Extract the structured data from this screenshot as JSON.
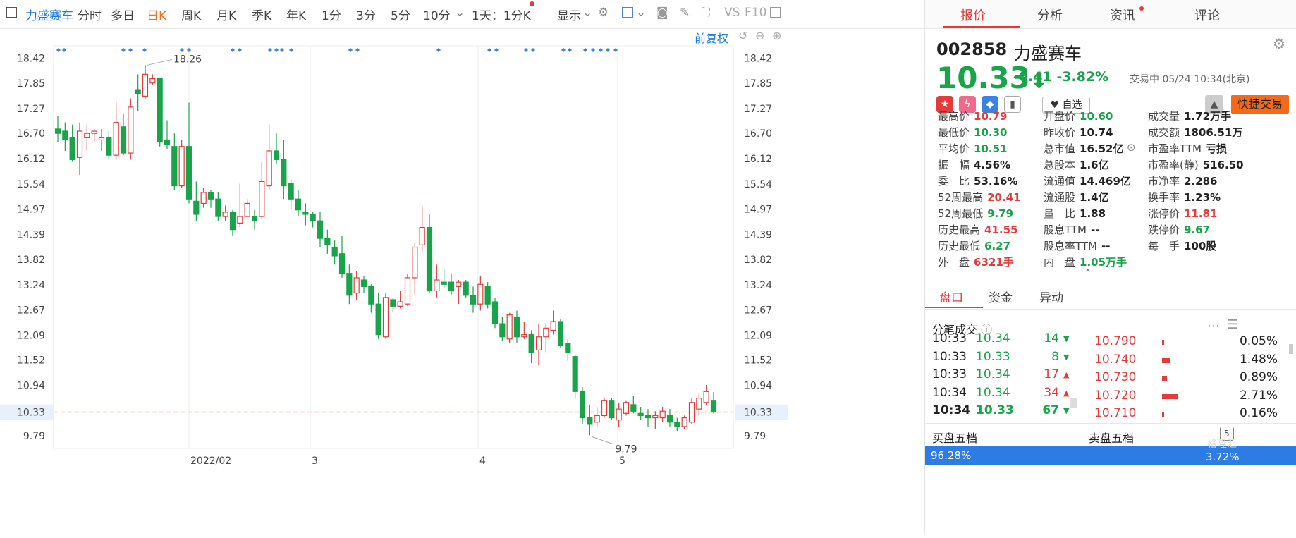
{
  "toolbar": {
    "stock_name": "力盛赛车",
    "periods": [
      "分时",
      "多日",
      "日K",
      "周K",
      "月K",
      "季K",
      "年K",
      "1分",
      "3分",
      "5分",
      "10分"
    ],
    "active_period": "日K",
    "dropdown": "1天：1分K",
    "display": "显示",
    "vs": "VS",
    "f10": "F10",
    "fuquan": "前复权"
  },
  "chart_data": {
    "type": "candlestick",
    "y_ticks": [
      "18.42",
      "17.85",
      "17.27",
      "16.70",
      "16.12",
      "15.54",
      "14.97",
      "14.39",
      "13.82",
      "13.24",
      "12.67",
      "12.09",
      "11.52",
      "10.94",
      "10.33",
      "9.79"
    ],
    "x_labels": [
      "2022/02",
      "3",
      "4",
      "5"
    ],
    "current_price_label": "10.33",
    "high_annotation": "18.26",
    "low_annotation": "9.79",
    "ylim": [
      9.5,
      18.7
    ],
    "candles": [
      [
        16.8,
        16.7,
        17.1,
        16.5
      ],
      [
        16.75,
        16.55,
        16.95,
        16.3
      ],
      [
        16.6,
        16.1,
        16.9,
        16.05
      ],
      [
        16.15,
        16.75,
        16.95,
        15.75
      ],
      [
        16.6,
        16.7,
        16.9,
        16.3
      ],
      [
        16.7,
        16.75,
        16.8,
        16.5
      ],
      [
        16.55,
        16.6,
        16.8,
        16.3
      ],
      [
        16.6,
        16.2,
        16.75,
        16.1
      ],
      [
        16.2,
        16.95,
        17.4,
        16.1
      ],
      [
        16.85,
        16.25,
        17.15,
        16.2
      ],
      [
        16.25,
        17.3,
        17.5,
        16.1
      ],
      [
        17.7,
        17.6,
        18.05,
        17.2
      ],
      [
        17.55,
        18.05,
        18.26,
        17.5
      ],
      [
        17.85,
        17.95,
        18.05,
        17.8
      ],
      [
        17.95,
        16.5,
        17.95,
        16.4
      ],
      [
        16.55,
        16.45,
        17.0,
        16.35
      ],
      [
        16.4,
        15.5,
        16.7,
        15.4
      ],
      [
        15.5,
        16.4,
        16.55,
        15.45
      ],
      [
        16.4,
        15.2,
        17.4,
        15.1
      ],
      [
        15.15,
        14.85,
        15.6,
        14.7
      ],
      [
        15.1,
        15.35,
        15.45,
        15.0
      ],
      [
        15.35,
        15.2,
        15.4,
        15.0
      ],
      [
        15.2,
        14.8,
        15.35,
        14.7
      ],
      [
        14.8,
        14.9,
        15.05,
        14.7
      ],
      [
        14.9,
        14.5,
        14.95,
        14.35
      ],
      [
        14.65,
        14.8,
        15.55,
        14.55
      ],
      [
        14.8,
        15.1,
        15.2,
        14.8
      ],
      [
        14.8,
        14.7,
        14.95,
        14.5
      ],
      [
        14.8,
        15.6,
        16.05,
        14.75
      ],
      [
        15.5,
        16.3,
        16.9,
        15.4
      ],
      [
        16.3,
        16.1,
        16.7,
        16.0
      ],
      [
        16.1,
        15.5,
        16.55,
        15.2
      ],
      [
        15.55,
        15.2,
        15.65,
        14.95
      ],
      [
        15.2,
        14.95,
        15.4,
        14.8
      ],
      [
        14.9,
        14.85,
        15.1,
        14.6
      ],
      [
        14.85,
        14.7,
        14.9,
        14.55
      ],
      [
        14.7,
        14.3,
        14.9,
        14.1
      ],
      [
        14.3,
        14.15,
        14.5,
        13.95
      ],
      [
        14.1,
        13.9,
        14.25,
        13.7
      ],
      [
        13.95,
        13.5,
        14.35,
        13.4
      ],
      [
        13.5,
        13.0,
        13.7,
        12.8
      ],
      [
        13.05,
        13.4,
        13.55,
        12.9
      ],
      [
        13.35,
        13.2,
        13.45,
        13.05
      ],
      [
        13.2,
        12.8,
        13.25,
        12.6
      ],
      [
        12.8,
        12.1,
        13.05,
        12.0
      ],
      [
        12.05,
        12.95,
        13.05,
        12.0
      ],
      [
        12.9,
        12.75,
        12.95,
        12.6
      ],
      [
        12.75,
        12.85,
        13.1,
        12.7
      ],
      [
        12.8,
        13.4,
        13.5,
        12.75
      ],
      [
        13.4,
        14.1,
        14.2,
        13.0
      ],
      [
        14.15,
        14.55,
        15.05,
        14.0
      ],
      [
        14.55,
        13.1,
        14.85,
        13.05
      ],
      [
        13.1,
        13.35,
        13.7,
        12.95
      ],
      [
        13.3,
        13.25,
        13.6,
        13.15
      ],
      [
        13.3,
        13.1,
        13.5,
        13.0
      ],
      [
        13.2,
        13.3,
        13.35,
        12.8
      ],
      [
        13.3,
        13.0,
        13.35,
        12.95
      ],
      [
        13.0,
        12.8,
        13.2,
        12.6
      ],
      [
        12.8,
        13.25,
        13.45,
        12.65
      ],
      [
        13.2,
        12.8,
        13.3,
        12.7
      ],
      [
        12.85,
        12.35,
        12.95,
        12.25
      ],
      [
        12.35,
        12.05,
        12.5,
        11.95
      ],
      [
        12.0,
        12.55,
        12.6,
        11.9
      ],
      [
        12.5,
        12.05,
        12.65,
        11.9
      ],
      [
        12.05,
        12.1,
        12.4,
        12.0
      ],
      [
        12.1,
        11.7,
        12.2,
        11.45
      ],
      [
        11.75,
        12.05,
        12.35,
        11.4
      ],
      [
        12.05,
        12.25,
        12.35,
        11.7
      ],
      [
        12.2,
        12.4,
        12.65,
        12.1
      ],
      [
        12.4,
        11.85,
        12.45,
        11.8
      ],
      [
        11.9,
        11.7,
        12.0,
        11.5
      ],
      [
        11.6,
        10.8,
        11.65,
        10.65
      ],
      [
        10.8,
        10.2,
        10.9,
        10.05
      ],
      [
        10.2,
        10.05,
        10.5,
        9.8
      ],
      [
        10.1,
        10.25,
        10.45,
        10.0
      ],
      [
        10.25,
        10.6,
        10.65,
        10.2
      ],
      [
        10.6,
        10.2,
        10.65,
        10.15
      ],
      [
        10.15,
        10.4,
        10.55,
        10.0
      ],
      [
        10.3,
        10.55,
        10.6,
        10.25
      ],
      [
        10.5,
        10.35,
        10.7,
        10.3
      ],
      [
        10.3,
        10.25,
        10.45,
        10.15
      ],
      [
        10.25,
        10.2,
        10.4,
        10.0
      ],
      [
        10.2,
        10.25,
        10.35,
        9.95
      ],
      [
        10.2,
        10.35,
        10.45,
        10.1
      ],
      [
        10.25,
        10.1,
        10.4,
        10.0
      ],
      [
        10.1,
        10.0,
        10.2,
        9.9
      ],
      [
        10.0,
        10.2,
        10.25,
        9.95
      ],
      [
        10.1,
        10.55,
        10.65,
        10.05
      ],
      [
        10.4,
        10.65,
        10.75,
        10.25
      ],
      [
        10.55,
        10.8,
        10.95,
        10.5
      ],
      [
        10.6,
        10.33,
        10.79,
        10.3
      ]
    ]
  },
  "quote": {
    "code": "002858",
    "name": "力盛赛车",
    "price": "10.33",
    "change": "-0.41",
    "change_pct": "-3.82%",
    "status": "交易中 05/24 10:34(北京)",
    "fav_label": "自选",
    "quick_trade": "快捷交易",
    "fields": [
      {
        "label": "最高价",
        "value": "10.79",
        "color": "red"
      },
      {
        "label": "开盘价",
        "value": "10.60",
        "color": "green"
      },
      {
        "label": "成交量",
        "value": "1.72万手",
        "color": "dark"
      },
      {
        "label": "最低价",
        "value": "10.30",
        "color": "green"
      },
      {
        "label": "昨收价",
        "value": "10.74",
        "color": "dark"
      },
      {
        "label": "成交额",
        "value": "1806.51万",
        "color": "dark"
      },
      {
        "label": "平均价",
        "value": "10.51",
        "color": "green"
      },
      {
        "label": "总市值",
        "value": "16.52亿",
        "color": "dark"
      },
      {
        "label": "市盈率TTM",
        "value": "亏损",
        "color": "dark"
      },
      {
        "label": "振　幅",
        "value": "4.56%",
        "color": "dark"
      },
      {
        "label": "总股本",
        "value": "1.6亿",
        "color": "dark"
      },
      {
        "label": "市盈率(静)",
        "value": "516.50",
        "color": "dark"
      },
      {
        "label": "委　比",
        "value": "53.16%",
        "color": "dark"
      },
      {
        "label": "流通值",
        "value": "14.469亿",
        "color": "dark"
      },
      {
        "label": "市净率",
        "value": "2.286",
        "color": "dark"
      },
      {
        "label": "52周最高",
        "value": "20.41",
        "color": "red"
      },
      {
        "label": "流通股",
        "value": "1.4亿",
        "color": "dark"
      },
      {
        "label": "换手率",
        "value": "1.23%",
        "color": "dark"
      },
      {
        "label": "52周最低",
        "value": "9.79",
        "color": "green"
      },
      {
        "label": "量　比",
        "value": "1.88",
        "color": "dark"
      },
      {
        "label": "涨停价",
        "value": "11.81",
        "color": "red"
      },
      {
        "label": "历史最高",
        "value": "41.55",
        "color": "red"
      },
      {
        "label": "股息TTM",
        "value": "--",
        "color": "dark"
      },
      {
        "label": "跌停价",
        "value": "9.67",
        "color": "green"
      },
      {
        "label": "历史最低",
        "value": "6.27",
        "color": "green"
      },
      {
        "label": "股息率TTM",
        "value": "--",
        "color": "dark"
      },
      {
        "label": "每　手",
        "value": "100股",
        "color": "dark"
      },
      {
        "label": "外　盘",
        "value": "6321手",
        "color": "red"
      },
      {
        "label": "内　盘",
        "value": "1.05万手",
        "color": "green"
      }
    ]
  },
  "subtabs": [
    "盘口",
    "资金",
    "异动"
  ],
  "trades_title": "分笔成交",
  "trades": [
    {
      "time": "10:33",
      "price": "10.34",
      "vol": "14",
      "dir": "down"
    },
    {
      "time": "10:33",
      "price": "10.33",
      "vol": "8",
      "dir": "down"
    },
    {
      "time": "10:33",
      "price": "10.34",
      "vol": "17",
      "dir": "up"
    },
    {
      "time": "10:34",
      "price": "10.34",
      "vol": "34",
      "dir": "up"
    },
    {
      "time": "10:34",
      "price": "10.33",
      "vol": "67",
      "dir": "down"
    }
  ],
  "levels": [
    {
      "price": "10.790",
      "pct": "0.05%",
      "bar": 0.05
    },
    {
      "price": "10.740",
      "pct": "1.48%",
      "bar": 1.48
    },
    {
      "price": "10.730",
      "pct": "0.89%",
      "bar": 0.89
    },
    {
      "price": "10.720",
      "pct": "2.71%",
      "bar": 2.71
    },
    {
      "price": "10.710",
      "pct": "0.16%",
      "bar": 0.16
    }
  ],
  "bottom": {
    "buy_title": "买盘五档",
    "sell_title": "卖盘五档",
    "buy_pct": "96.28%",
    "sell_pct": "3.72%",
    "watermark": "格隆汇"
  },
  "colors": {
    "up": "#e33b3b",
    "down": "#19a34a",
    "accent": "#f5701f",
    "blue": "#1f7be0"
  }
}
